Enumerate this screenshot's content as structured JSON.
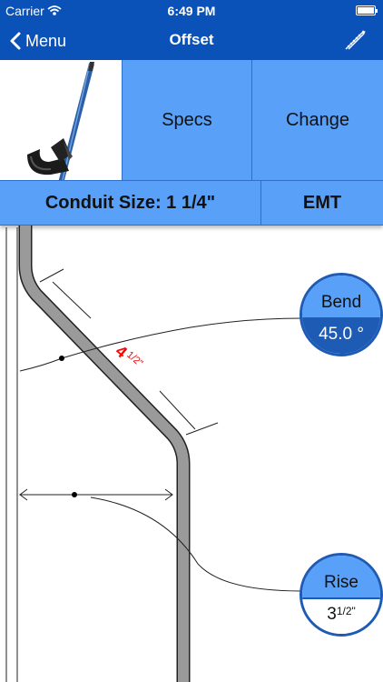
{
  "status": {
    "carrier": "Carrier",
    "time": "6:49 PM"
  },
  "nav": {
    "back_label": "Menu",
    "title": "Offset"
  },
  "buttons": {
    "specs": "Specs",
    "change": "Change"
  },
  "conduit": {
    "size_label": "Conduit Size: 1 1/4\"",
    "type": "EMT"
  },
  "diagram": {
    "length_whole": "4",
    "length_fraction": "1/2\"",
    "bend": {
      "label": "Bend",
      "value": "45.0 °"
    },
    "rise": {
      "label": "Rise",
      "whole": "3",
      "fraction": "1/2\""
    }
  },
  "colors": {
    "primary": "#0a51b8",
    "button": "#58a0f8",
    "accent": "#1e5bb5",
    "measure": "#ff0000"
  },
  "icons": [
    "wifi-icon",
    "battery-icon",
    "back-chevron-icon",
    "tape-measure-icon",
    "pipe-bender-tool-image"
  ]
}
